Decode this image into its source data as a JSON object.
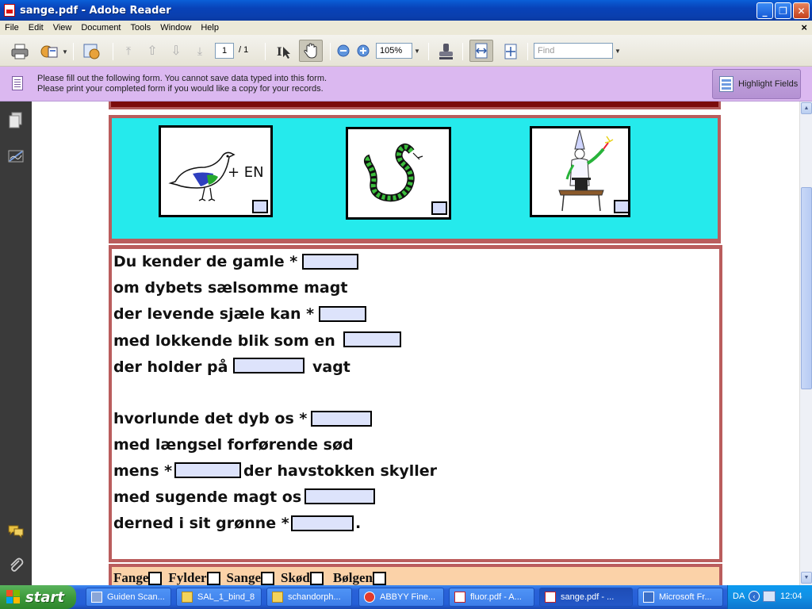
{
  "window": {
    "title": "sange.pdf - Adobe Reader"
  },
  "menu": [
    "File",
    "Edit",
    "View",
    "Document",
    "Tools",
    "Window",
    "Help"
  ],
  "toolbar": {
    "page_current": "1",
    "page_total": "/ 1",
    "zoom": "105%",
    "find_placeholder": "Find"
  },
  "formbar": {
    "message_line1": "Please fill out the following form. You cannot save data typed into this form.",
    "message_line2": "Please print your completed form if you would like a copy for your records.",
    "highlight_label": "Highlight Fields"
  },
  "pictures": [
    {
      "icon": "bird-drawing",
      "caption": "+ EN"
    },
    {
      "icon": "snake-drawing"
    },
    {
      "icon": "magician-drawing"
    }
  ],
  "verses": [
    "Du kender de gamle *",
    "om dybets sælsomme magt",
    "der levende sjæle kan *",
    "med lokkende blik som en",
    "der holder på",
    "vagt",
    "hvorlunde det dyb os *",
    "med længsel forførende sød",
    "mens *",
    "der havstokken skyller",
    "med sugende magt os",
    "derned i sit grønne *",
    "."
  ],
  "answers": [
    "Fange",
    "Fylder",
    "Sange",
    "Skød",
    "Bølgen"
  ],
  "taskbar": {
    "start_label": "start",
    "tasks": [
      "Guiden Scan...",
      "SAL_1_bind_8",
      "schandorph...",
      "ABBYY Fine...",
      "fluor.pdf - A...",
      "sange.pdf - ...",
      "Microsoft Fr..."
    ],
    "lang": "DA",
    "clock": "12:04"
  },
  "colors": {
    "cyan_panel": "#25eaec",
    "frame": "#ba5d5d",
    "field": "#dde3fb",
    "answer_bg": "#fbd2a8"
  }
}
